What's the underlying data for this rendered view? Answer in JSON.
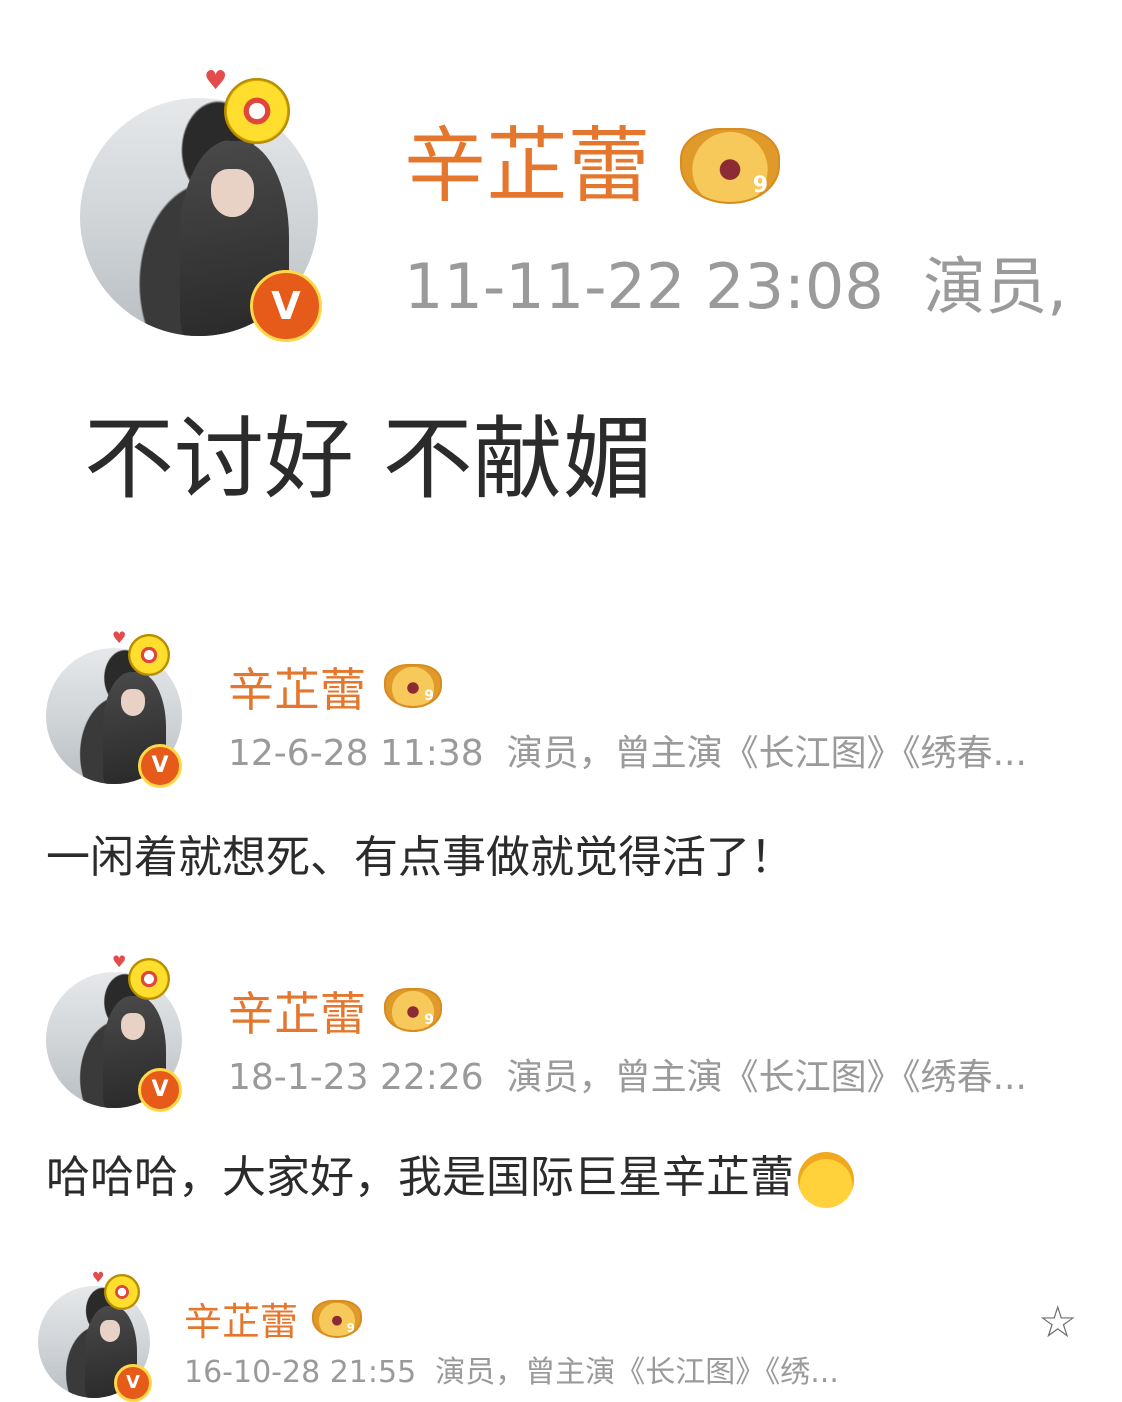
{
  "posts": [
    {
      "username": "辛芷蕾",
      "timestamp": "11-11-22 23:08",
      "bio": "演员,",
      "content": "不讨好 不献媚",
      "member_level": "9",
      "verified_badge": "V"
    },
    {
      "username": "辛芷蕾",
      "timestamp": "12-6-28 11:38",
      "bio": "演员，曾主演《长江图》《绣春...",
      "content": "一闲着就想死、有点事做就觉得活了！",
      "member_level": "9",
      "verified_badge": "V"
    },
    {
      "username": "辛芷蕾",
      "timestamp": "18-1-23 22:26",
      "bio": "演员，曾主演《长江图》《绣春...",
      "content": "哈哈哈，大家好，我是国际巨星辛芷蕾",
      "content_emoji": "laughing-crying-emoji",
      "member_level": "9",
      "verified_badge": "V"
    },
    {
      "username": "辛芷蕾",
      "timestamp": "16-10-28 21:55",
      "bio": "演员，曾主演《长江图》《绣...",
      "member_level": "9",
      "verified_badge": "V",
      "star_icon": "☆"
    }
  ],
  "colors": {
    "username": "#e4772d",
    "meta": "#9a9a9a",
    "text": "#2b2b2b",
    "verified": "#e65a1a"
  }
}
